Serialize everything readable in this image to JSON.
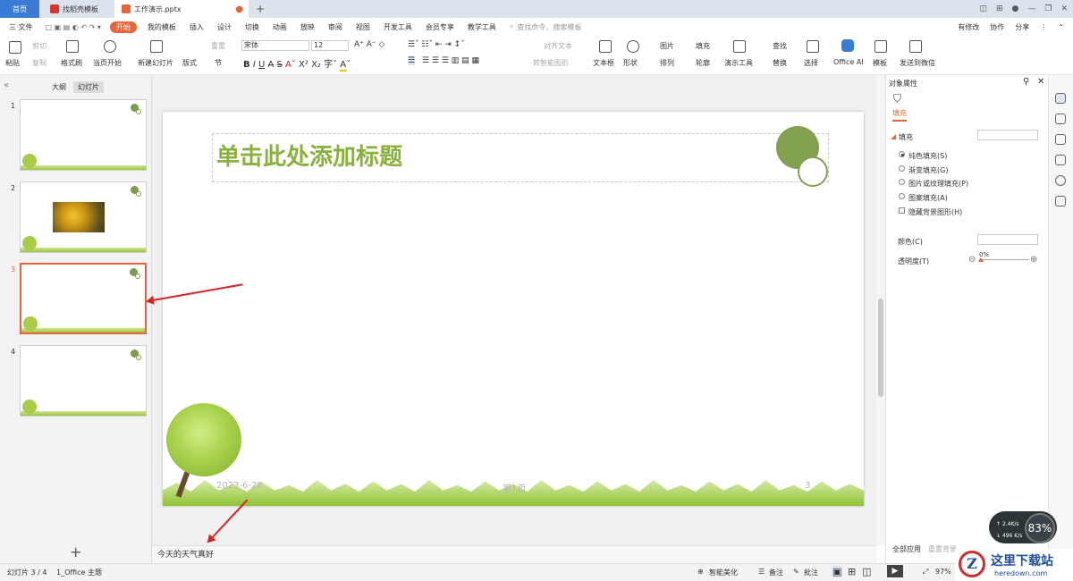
{
  "tabs": {
    "home": "首页",
    "template": "找稻壳模板",
    "file": "工作演示.pptx"
  },
  "menu": {
    "file": "三 文件",
    "items": [
      "我的模板",
      "插入",
      "设计",
      "切换",
      "动画",
      "放映",
      "审阅",
      "视图",
      "开发工具",
      "会员专享",
      "教学工具"
    ],
    "active": "开始",
    "search": "查找命令、搜索模板",
    "right": [
      "有修改",
      "协作",
      "分享"
    ]
  },
  "ribbon": {
    "paste": "粘贴",
    "cut": "剪切",
    "copy": "复制",
    "format_painter": "格式刷",
    "from_start": "当页开始",
    "new_slide": "新建幻灯片",
    "layout": "版式",
    "section": "节",
    "reset": "重置",
    "font": "宋体",
    "size": "12",
    "align_text": "对齐文本",
    "smartart": "转智能图形",
    "textbox": "文本框",
    "shape": "形状",
    "picture": "图片",
    "arrange": "排列",
    "fill": "填充",
    "outline": "轮廓",
    "demo_tools": "演示工具",
    "find": "查找",
    "replace": "替换",
    "select": "选择",
    "office_ai": "Office AI",
    "template": "模板",
    "send": "发送到微信"
  },
  "left_panel": {
    "outline_tab": "大纲",
    "slides_tab": "幻灯片",
    "thumbs": [
      "1",
      "2",
      "3",
      "4"
    ]
  },
  "slide": {
    "title": "单击此处添加标题",
    "date": "2023-6-28",
    "page": "第1页",
    "number": "3"
  },
  "notes": "今天的天气真好",
  "right_pane": {
    "header": "对象属性",
    "tab": "填充",
    "section": "填充",
    "options": [
      "纯色填充(S)",
      "渐变填充(G)",
      "图片或纹理填充(P)",
      "图案填充(A)"
    ],
    "hide_bg": "隐藏背景图形(H)",
    "color": "颜色(C)",
    "transparency": "透明度(T)",
    "transparency_value": "0%",
    "apply_all": "全部应用",
    "reset_bg": "重置背景"
  },
  "status": {
    "slide_info": "幻灯片 3 / 4",
    "theme": "1_Office 主题",
    "smart": "智能美化",
    "notes": "备注",
    "comment": "批注",
    "zoom": "97%"
  },
  "speed": {
    "up": "2.4K/s",
    "down": "496 K/s",
    "percent": "83%"
  },
  "watermark": {
    "logo": "Z",
    "title": "这里下载站",
    "url": "heredown.com"
  },
  "colors": {
    "accent": "#e8643a",
    "title_green": "#8ab13c",
    "arrow": "#d62424"
  }
}
